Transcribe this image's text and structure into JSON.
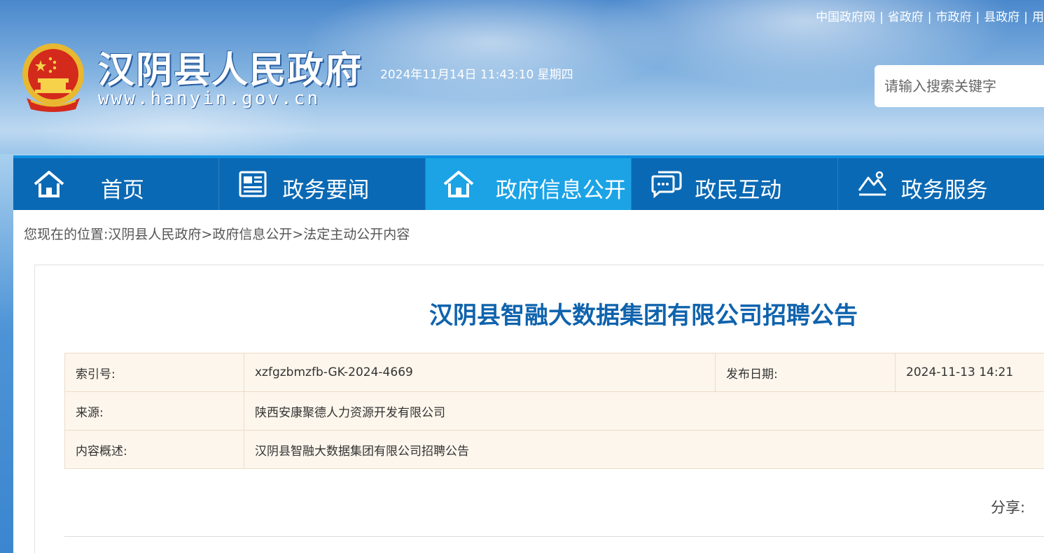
{
  "top_links": [
    "中国政府网",
    "省政府",
    "市政府",
    "县政府",
    "用"
  ],
  "site": {
    "title": "汉阴县人民政府",
    "url": "www.hanyin.gov.cn",
    "datetime": "2024年11月14日 11:43:10 星期四"
  },
  "search": {
    "placeholder": "请输入搜索关键字"
  },
  "nav": [
    {
      "label": "首页",
      "icon": "home-icon"
    },
    {
      "label": "政务要闻",
      "icon": "newspaper-icon"
    },
    {
      "label": "政府信息公开",
      "icon": "home-icon",
      "active": true
    },
    {
      "label": "政民互动",
      "icon": "chat-icon"
    },
    {
      "label": "政务服务",
      "icon": "mountain-icon"
    }
  ],
  "breadcrumb": "您现在的位置:汉阴县人民政府>政府信息公开>法定主动公开内容",
  "article": {
    "title": "汉阴县智融大数据集团有限公司招聘公告",
    "meta": {
      "index_label": "索引号:",
      "index_value": "xzfgzbmzfb-GK-2024-4669",
      "date_label": "发布日期:",
      "date_value": "2024-11-13 14:21",
      "source_label": "来源:",
      "source_value": "陕西安康聚德人力资源开发有限公司",
      "summary_label": "内容概述:",
      "summary_value": "汉阴县智融大数据集团有限公司招聘公告"
    },
    "share_label": "分享:"
  },
  "colors": {
    "nav_bg": "#0a69b4",
    "nav_active": "#1ba3e6",
    "title_blue": "#0f63ad",
    "meta_bg": "#fdf6ec"
  }
}
